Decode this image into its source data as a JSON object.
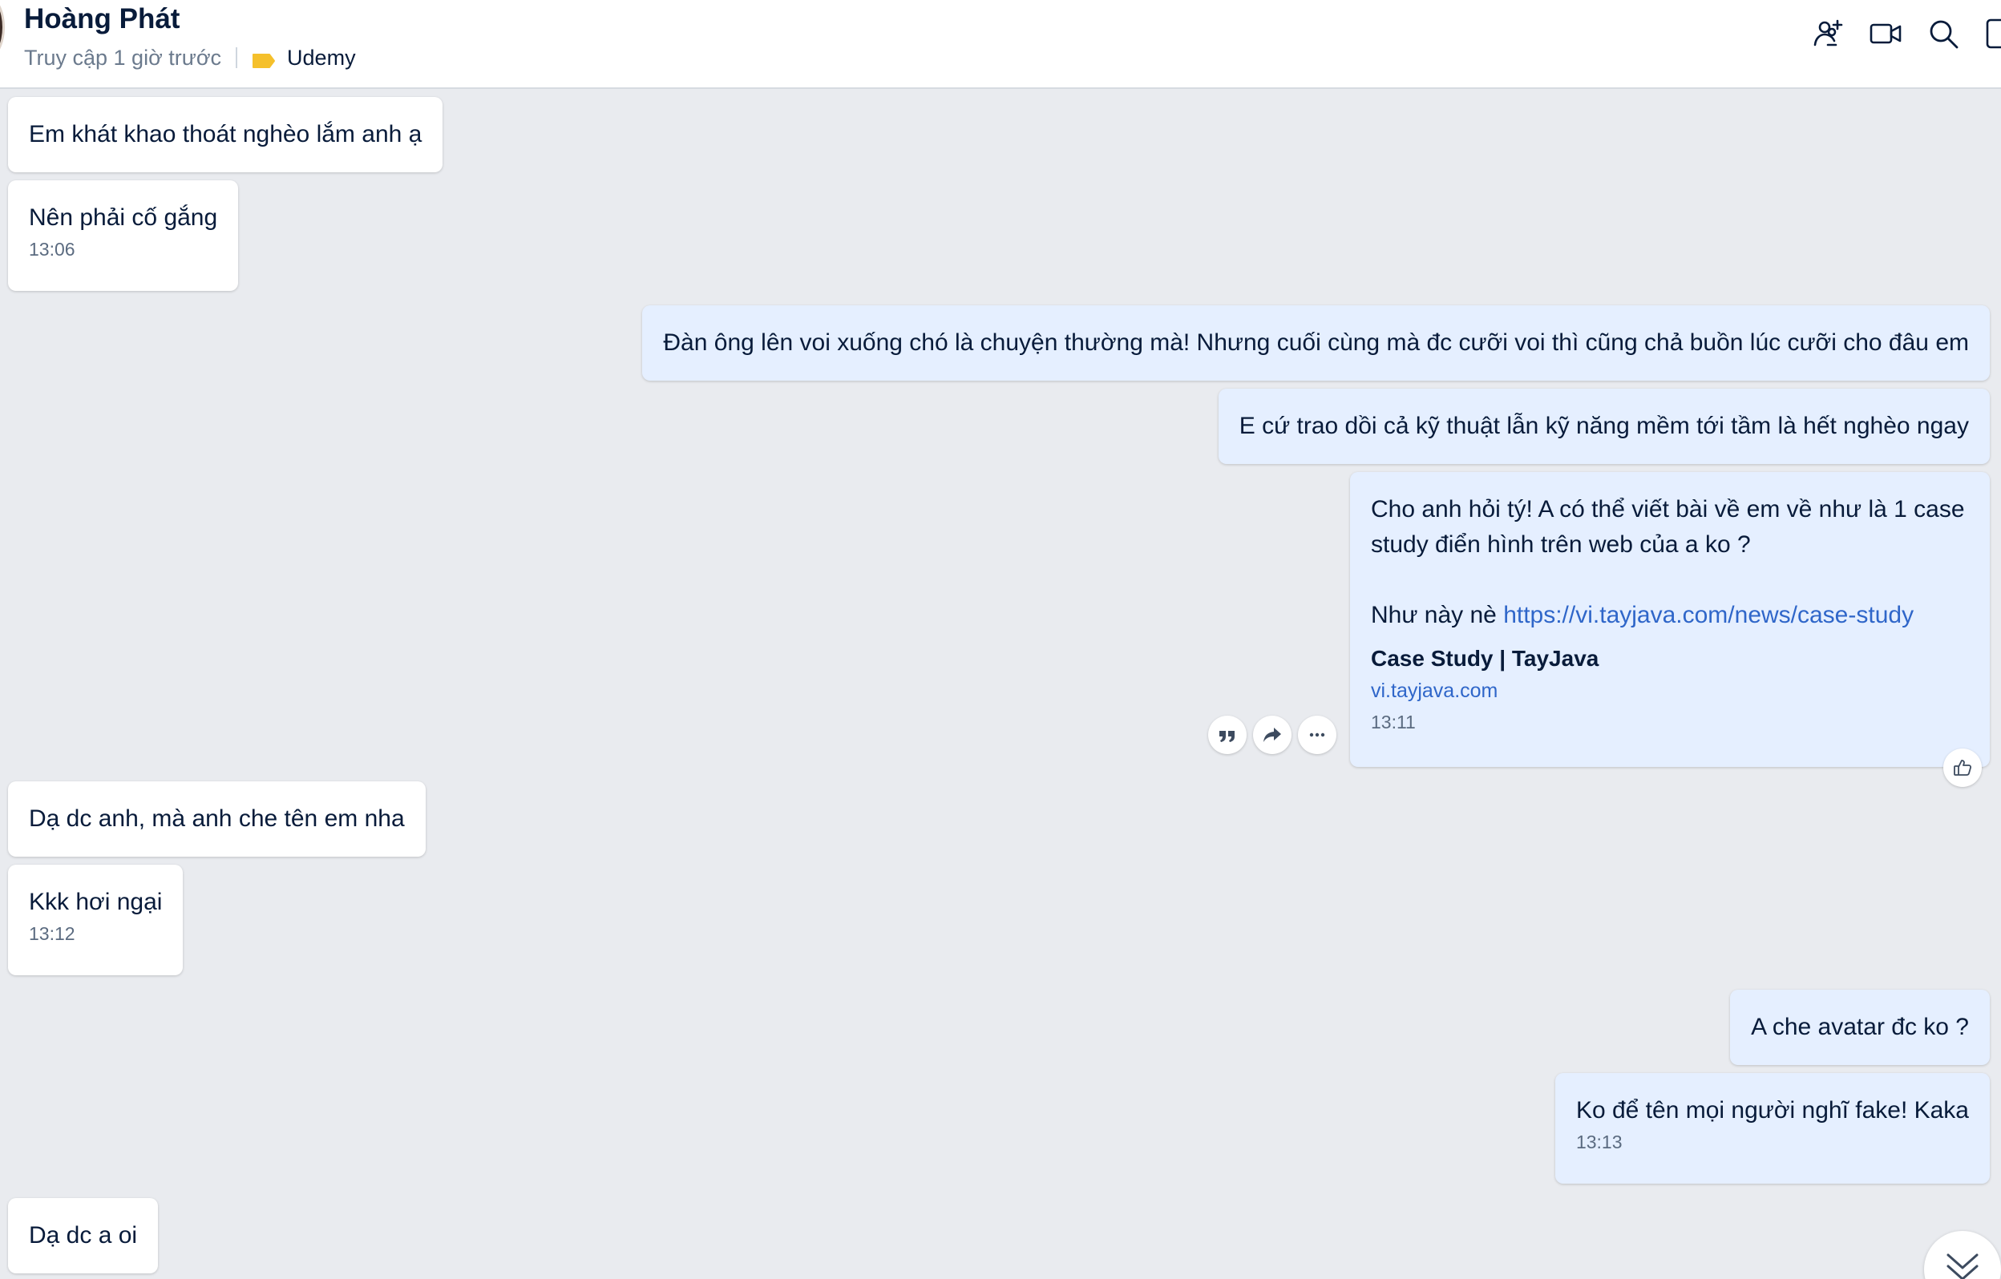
{
  "header": {
    "name": "Hoàng Phát",
    "last_seen": "Truy cập 1 giờ trước",
    "tag_label": "Udemy",
    "tag_color": "#f5c02b"
  },
  "header_icons": [
    "add-member-icon",
    "video-call-icon",
    "search-icon",
    "side-panel-icon"
  ],
  "messages": [
    {
      "side": "in",
      "text": "Em khát khao thoát nghèo lắm anh ạ"
    },
    {
      "side": "in",
      "text": "Nên phải cố gắng",
      "time": "13:06"
    },
    {
      "side": "out",
      "text": "Đàn ông lên voi xuống chó là chuyện thường mà! Nhưng cuối cùng mà đc cưỡi voi thì cũng chả buồn lúc cưỡi cho đâu em"
    },
    {
      "side": "out",
      "text": "E cứ trao dồi cả kỹ thuật lẫn kỹ năng mềm tới tầm là hết nghèo ngay"
    },
    {
      "side": "out",
      "text_line1": "Cho anh hỏi tý! A có thể viết bài về em về như là 1 case",
      "text_line2": "study điển hình trên web của a ko ?",
      "link_prefix": "Như này nè ",
      "link_url": "https://vi.tayjava.com/news/case-study",
      "preview_title": "Case Study | TayJava",
      "preview_domain": "vi.tayjava.com",
      "time": "13:11"
    },
    {
      "side": "in",
      "text": "Dạ dc anh, mà anh che tên em nha"
    },
    {
      "side": "in",
      "text": "Kkk hơi ngại",
      "time": "13:12"
    },
    {
      "side": "out",
      "text": "A che avatar đc ko ?"
    },
    {
      "side": "out",
      "text": "Ko để tên mọi người nghĩ fake! Kaka",
      "time": "13:13"
    },
    {
      "side": "in",
      "text": "Dạ dc a oi"
    }
  ],
  "message_actions": [
    "quote-icon",
    "forward-icon",
    "more-icon"
  ],
  "reaction_icon": "like-icon",
  "colors": {
    "incoming_bubble": "#ffffff",
    "outgoing_bubble": "#e5efff",
    "background": "#e9ebef",
    "link": "#2f66c9"
  }
}
